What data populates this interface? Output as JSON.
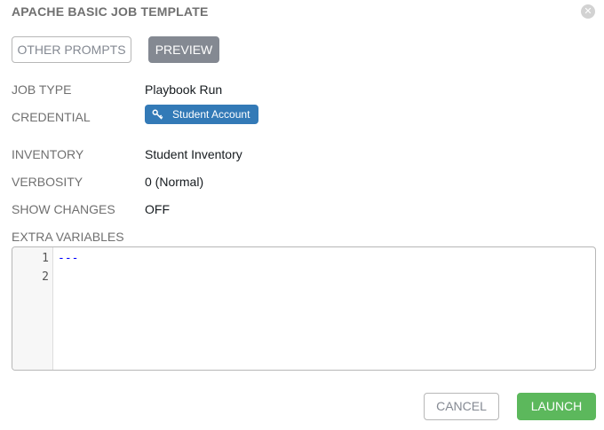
{
  "dialog": {
    "title": "APACHE BASIC JOB TEMPLATE",
    "close_icon": "close-icon"
  },
  "tabs": [
    {
      "label": "OTHER PROMPTS",
      "active": false
    },
    {
      "label": "PREVIEW",
      "active": true
    }
  ],
  "fields": {
    "job_type": {
      "label": "JOB TYPE",
      "value": "Playbook Run"
    },
    "credential": {
      "label": "CREDENTIAL",
      "value": "Student Account",
      "icon": "key-icon"
    },
    "inventory": {
      "label": "INVENTORY",
      "value": "Student Inventory"
    },
    "verbosity": {
      "label": "VERBOSITY",
      "value": "0 (Normal)"
    },
    "show_changes": {
      "label": "SHOW CHANGES",
      "value": "OFF"
    },
    "extra_variables": {
      "label": "EXTRA VARIABLES"
    }
  },
  "editor": {
    "line_numbers": [
      "1",
      "2"
    ],
    "lines": [
      "---",
      ""
    ]
  },
  "actions": {
    "cancel_label": "CANCEL",
    "launch_label": "LAUNCH"
  },
  "colors": {
    "credential_tag": "#337ab7",
    "launch_button": "#5cb85c",
    "active_tab": "#848992",
    "yaml_text": "#0000ff"
  }
}
